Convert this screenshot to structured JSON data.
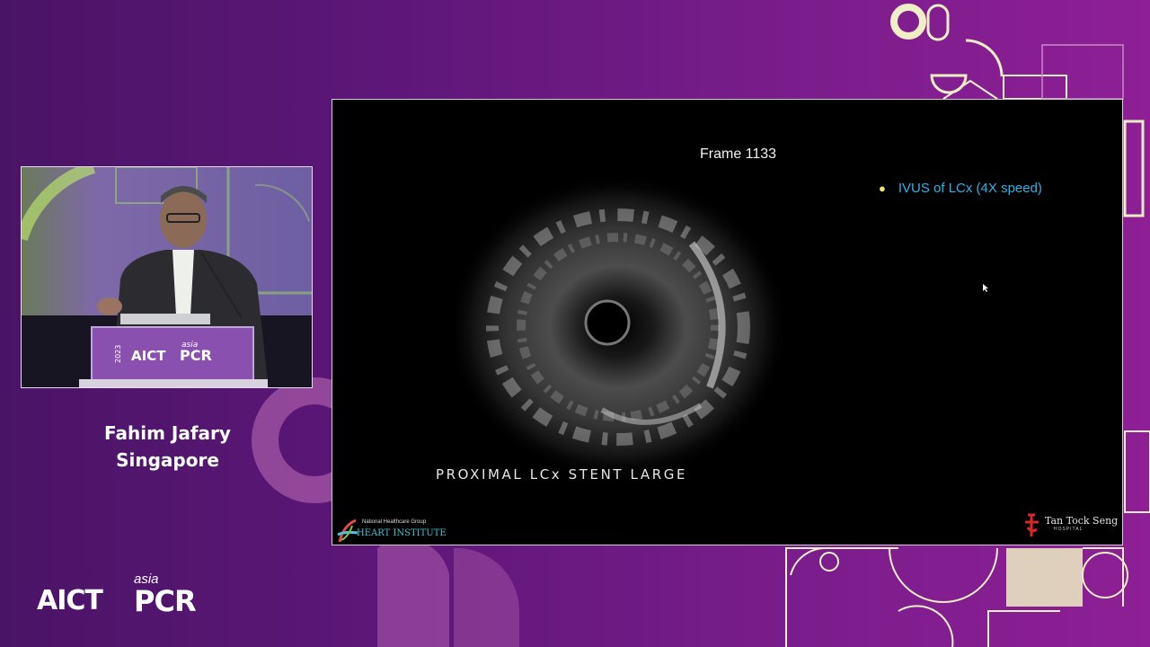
{
  "speaker": {
    "name": "Fahim Jafary",
    "location": "Singapore",
    "podium_year": "2023",
    "podium_brand": "AICT",
    "podium_asia": "asia",
    "podium_pcr": "PCR"
  },
  "slide": {
    "frame_label": "Frame 1133",
    "bullet": "IVUS of LCx (4X speed)",
    "ivus_caption": "PROXIMAL LCx STENT LARGE",
    "left_logo_small": "National Healthcare Group",
    "left_logo_big": "HEART INSTITUTE",
    "right_logo_name": "Tan Tock Seng",
    "right_logo_sub": "HOSPITAL"
  },
  "event_logo": {
    "aict": "AICT",
    "asia": "asia",
    "pcr": "PCR"
  },
  "colors": {
    "background": "#5e1779",
    "accent_cream": "#f0efc2",
    "bullet_text": "#2bb3e6",
    "bullet_dot": "#f0e86a"
  }
}
